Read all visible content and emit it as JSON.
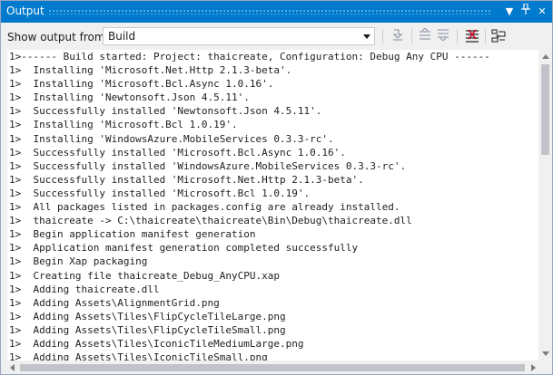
{
  "panel": {
    "title": "Output",
    "accent_color": "#007acc",
    "titlebar_buttons": [
      {
        "name": "window-menu-icon",
        "glyph": "▼"
      },
      {
        "name": "pin-icon",
        "glyph": "⊥"
      },
      {
        "name": "close-icon",
        "glyph": "✕"
      }
    ]
  },
  "toolbar": {
    "show_output_label": "Show output from:",
    "source_selected": "Build",
    "buttons": [
      {
        "name": "go-to-error-icon"
      },
      {
        "name": "find-previous-icon"
      },
      {
        "name": "find-next-icon"
      },
      {
        "name": "clear-all-icon"
      },
      {
        "name": "toggle-word-wrap-icon"
      }
    ]
  },
  "output": {
    "lines": [
      "1>------ Build started: Project: thaicreate, Configuration: Debug Any CPU ------",
      "1>  Installing 'Microsoft.Net.Http 2.1.3-beta'.",
      "1>  Installing 'Microsoft.Bcl.Async 1.0.16'.",
      "1>  Installing 'Newtonsoft.Json 4.5.11'.",
      "1>  Successfully installed 'Newtonsoft.Json 4.5.11'.",
      "1>  Installing 'Microsoft.Bcl 1.0.19'.",
      "1>  Installing 'WindowsAzure.MobileServices 0.3.3-rc'.",
      "1>  Successfully installed 'Microsoft.Bcl.Async 1.0.16'.",
      "1>  Successfully installed 'WindowsAzure.MobileServices 0.3.3-rc'.",
      "1>  Successfully installed 'Microsoft.Net.Http 2.1.3-beta'.",
      "1>  Successfully installed 'Microsoft.Bcl 1.0.19'.",
      "1>  All packages listed in packages.config are already installed.",
      "1>  thaicreate -> C:\\thaicreate\\thaicreate\\Bin\\Debug\\thaicreate.dll",
      "1>  Begin application manifest generation",
      "1>  Application manifest generation completed successfully",
      "1>  Begin Xap packaging",
      "1>  Creating file thaicreate_Debug_AnyCPU.xap",
      "1>  Adding thaicreate.dll",
      "1>  Adding Assets\\AlignmentGrid.png",
      "1>  Adding Assets\\Tiles\\FlipCycleTileLarge.png",
      "1>  Adding Assets\\Tiles\\FlipCycleTileSmall.png",
      "1>  Adding Assets\\Tiles\\IconicTileMediumLarge.png",
      "1>  Adding Assets\\Tiles\\IconicTileSmall.png"
    ]
  }
}
